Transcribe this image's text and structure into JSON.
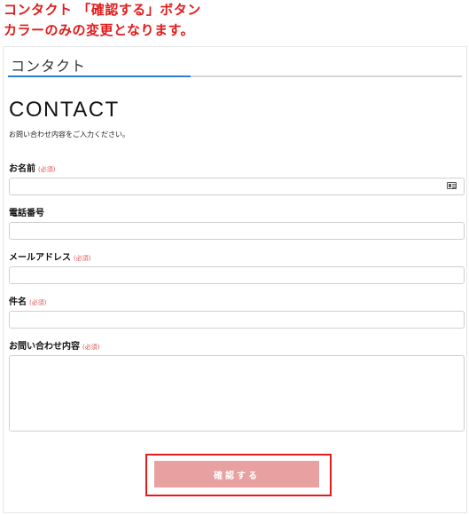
{
  "annotation": {
    "line1": "コンタクト 「確認する」ボタン",
    "line2": "カラーのみの変更となります。"
  },
  "tab": {
    "label": "コンタクト"
  },
  "page": {
    "title": "CONTACT",
    "lead": "お問い合わせ内容をご入力ください。"
  },
  "form": {
    "required_mark": "(必須)",
    "fields": [
      {
        "label": "お名前",
        "required": true,
        "value": ""
      },
      {
        "label": "電話番号",
        "required": false,
        "value": ""
      },
      {
        "label": "メールアドレス",
        "required": true,
        "value": ""
      },
      {
        "label": "件名",
        "required": true,
        "value": ""
      },
      {
        "label": "お問い合わせ内容",
        "required": true,
        "value": ""
      }
    ],
    "submit_label": "確認する"
  },
  "colors": {
    "annotation": "#e21b1b",
    "tab_active": "#2e7fd3",
    "submit_button": "#e8a0a0",
    "required": "#d9534f"
  },
  "icons": {
    "name_field_icon": "contact-card-icon"
  }
}
